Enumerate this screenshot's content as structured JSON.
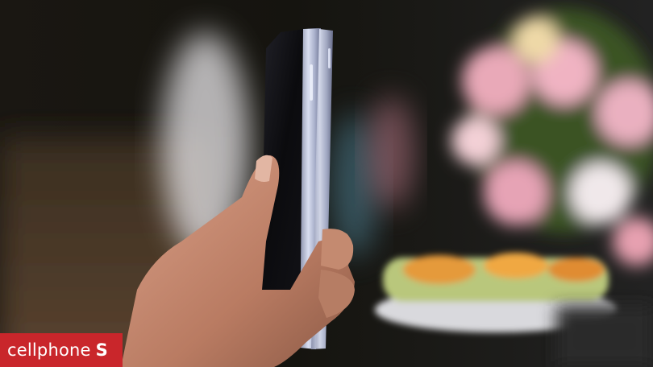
{
  "photo": {
    "subject": "hand-holding-folded-smartphone",
    "colors": {
      "background_dark": "#14130f",
      "phone_frame": "#b9bfd6",
      "phone_screen": "#0d0d10",
      "skin": "#c98f73",
      "flowers_pink": "#e7a7b8",
      "cake_orange": "#e59a3a",
      "cake_green": "#b6c67a"
    }
  },
  "watermark": {
    "brand": "cellphone",
    "suffix": "S",
    "color": "#c9262b"
  }
}
